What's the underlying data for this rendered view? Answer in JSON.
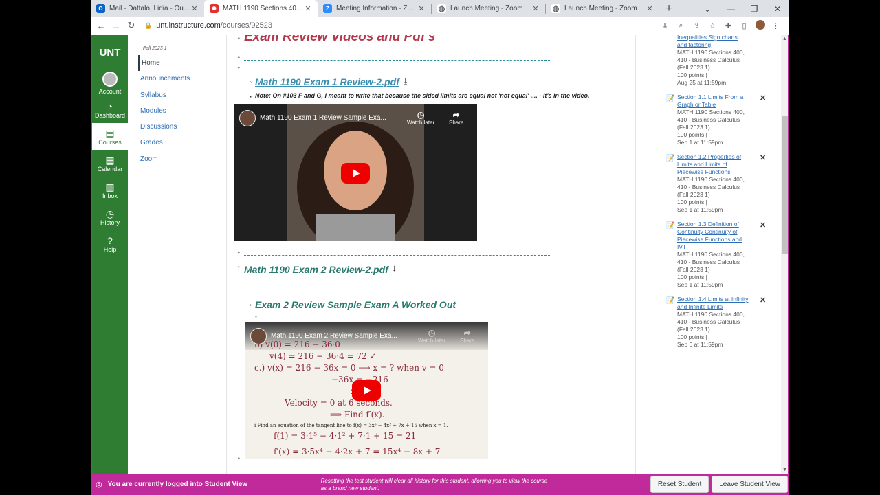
{
  "browser": {
    "tabs": [
      {
        "title": "Mail - Dattalo, Lidia - Outlook",
        "icon": "outlook-icon",
        "color": "#0a64c8",
        "glyph": "O"
      },
      {
        "title": "MATH 1190 Sections 400, 410 -",
        "icon": "canvas-icon",
        "color": "#e0312f",
        "glyph": "✺"
      },
      {
        "title": "Meeting Information - Zoom",
        "icon": "zoom-icon",
        "color": "#2d8cff",
        "glyph": "Z"
      },
      {
        "title": "Launch Meeting - Zoom",
        "icon": "globe-icon",
        "color": "#5f6368",
        "glyph": "◍"
      },
      {
        "title": "Launch Meeting - Zoom",
        "icon": "globe-icon",
        "color": "#5f6368",
        "glyph": "◍"
      }
    ],
    "url_host": "unt.instructure.com",
    "url_path": "/courses/92523"
  },
  "global_nav": {
    "logo": "UNT",
    "items": [
      {
        "label": "Account",
        "icon": "account-icon",
        "glyph": ""
      },
      {
        "label": "Dashboard",
        "icon": "dashboard-icon",
        "glyph": "◔"
      },
      {
        "label": "Courses",
        "icon": "courses-icon",
        "glyph": "▤"
      },
      {
        "label": "Calendar",
        "icon": "calendar-icon",
        "glyph": "▦"
      },
      {
        "label": "Inbox",
        "icon": "inbox-icon",
        "glyph": "▥"
      },
      {
        "label": "History",
        "icon": "history-icon",
        "glyph": "◷"
      },
      {
        "label": "Help",
        "icon": "help-icon",
        "glyph": "?"
      }
    ]
  },
  "course_nav": {
    "term": "Fall 2023 1",
    "items": [
      "Home",
      "Announcements",
      "Syllabus",
      "Modules",
      "Discussions",
      "Grades",
      "Zoom"
    ]
  },
  "content": {
    "heading": "Exam Review Videos and Pdf's",
    "dashes": "_ _ _ _ _ _ _ _ _ _ _ _ _ _ _ _ _ _ _ _ _ _ _ _ _ _ _ _ _ _ _ _ _ _ _ _ _ _ _ _ _ _ _ _ _ _ _ _",
    "exam1_link": "Math 1190 Exam 1 Review-2.pdf",
    "exam1_note": "Note: On #103 F and G, I meant to write that because the sided limits are equal not 'not equal' .... - it's in the video.",
    "video1_title": "Math 1190 Exam 1 Review Sample Exa...",
    "watch_later": "Watch later",
    "share": "Share",
    "exam2_link": "Math 1190 Exam 2 Review-2.pdf",
    "sample_heading": "Exam 2 Review Sample Exam A Worked Out",
    "video2_title": "Math 1190 Exam 2 Review Sample Exa...",
    "video2_lines": [
      "b)  v(0) = 216 − 36·0",
      "v(4) = 216 − 36·4 = 72 ✓",
      "c.)  v(x) = 216 − 36x = 0   ⟶  x = ? when v = 0",
      "−36x = −216",
      "x = 6 ✓",
      "Velocity = 0  at 6 seconds.",
      "⟹ Find f′(x).",
      "i   Find an equation of the tangent line to f(x) = 3x⁵ − 4x² + 7x + 15 when x = 1.",
      "f(1) = 3·1⁵ − 4·1² + 7·1 + 15 = 21",
      "f′(x) = 3·5x⁴ − 4·2x + 7 = 15x⁴ − 8x + 7"
    ]
  },
  "todo": [
    {
      "title": "Inequalities Sign charts and factoring",
      "course": "MATH 1190 Sections 400, 410 - Business Calculus (Fall 2023 1)",
      "points": "100 points  |",
      "due": "Aug 25 at 11:59pm",
      "closable": false
    },
    {
      "title": "Section 1.1 Limits From a Graph or Table",
      "course": "MATH 1190 Sections 400, 410 - Business Calculus (Fall 2023 1)",
      "points": "100 points  |",
      "due": "Sep 1 at 11:59pm",
      "closable": true
    },
    {
      "title": "Section 1.2 Properties of Limits and Limits of Piecewise Functions",
      "course": "MATH 1190 Sections 400, 410 - Business Calculus (Fall 2023 1)",
      "points": "100 points  |",
      "due": "Sep 1 at 11:59pm",
      "closable": true
    },
    {
      "title": "Section 1.3 Definition of Continuity Continuity of Piecewise Functions and IVT",
      "course": "MATH 1190 Sections 400, 410 - Business Calculus (Fall 2023 1)",
      "points": "100 points  |",
      "due": "Sep 1 at 11:59pm",
      "closable": true
    },
    {
      "title": "Section 1.4 Limits at Infinity and Infinite Limits",
      "course": "MATH 1190 Sections 400, 410 - Business Calculus (Fall 2023 1)",
      "points": "100 points  |",
      "due": "Sep 6 at 11:59pm",
      "closable": true
    }
  ],
  "footer": {
    "status": "You are currently logged into Student View",
    "note": "Resetting the test student will clear all history for this student, allowing you to view the course as a brand new student.",
    "reset_label": "Reset Student",
    "leave_label": "Leave Student View"
  },
  "colors": {
    "canvas_green": "#2e7d32",
    "student_view_magenta": "#c02a9a",
    "link_blue": "#2d6db5",
    "heading_red": "#b3394e"
  }
}
